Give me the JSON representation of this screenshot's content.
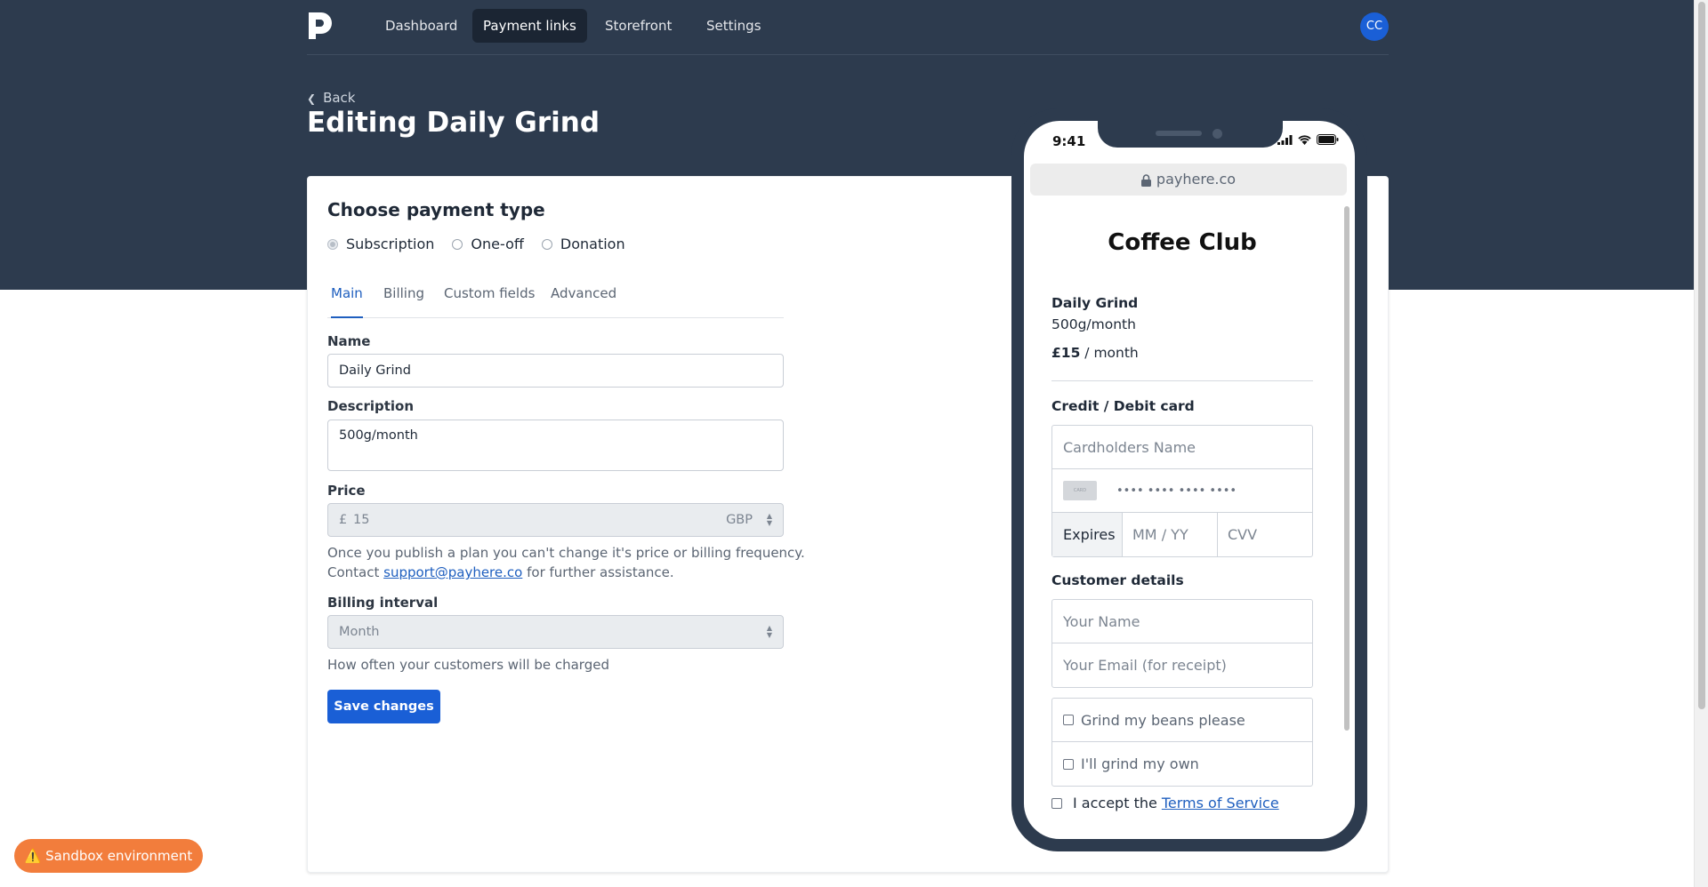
{
  "nav": {
    "items": [
      "Dashboard",
      "Payment links",
      "Storefront",
      "Settings"
    ],
    "active": "Payment links",
    "avatar": "CC"
  },
  "header": {
    "back": "Back",
    "title": "Editing Daily Grind"
  },
  "form": {
    "section_title": "Choose payment type",
    "payment_types": [
      "Subscription",
      "One-off",
      "Donation"
    ],
    "selected_type": "Subscription",
    "tabs": [
      "Main",
      "Billing",
      "Custom fields",
      "Advanced"
    ],
    "active_tab": "Main",
    "name_label": "Name",
    "name_value": "Daily Grind",
    "description_label": "Description",
    "description_value": "500g/month",
    "price_label": "Price",
    "price_currency_symbol": "£",
    "price_value": "15",
    "price_currency": "GBP",
    "price_help_1": "Once you publish a plan you can't change it's price or billing frequency.",
    "price_help_contact": "Contact",
    "support_email": "support@payhere.co",
    "price_help_2": "for further assistance.",
    "interval_label": "Billing interval",
    "interval_value": "Month",
    "interval_help": "How often your customers will be charged",
    "save_button": "Save changes"
  },
  "preview": {
    "time": "9:41",
    "url": "payhere.co",
    "store_name": "Coffee Club",
    "plan_name": "Daily Grind",
    "plan_description": "500g/month",
    "price_amount": "£15",
    "price_period": "/ month",
    "card_section": "Credit / Debit card",
    "cardholder_placeholder": "Cardholders Name",
    "card_number_placeholder": "•••• •••• •••• ••••",
    "card_icon_text": "CARD",
    "expires_label": "Expires",
    "expiry_placeholder": "MM / YY",
    "cvv_placeholder": "CVV",
    "customer_section": "Customer details",
    "name_placeholder": "Your Name",
    "email_placeholder": "Your Email (for receipt)",
    "option_1": "Grind my beans please",
    "option_2": "I'll grind my own",
    "tos_prefix": "I accept the",
    "tos_link": "Terms of Service"
  },
  "sandbox": "⚠️ Sandbox environment",
  "colors": {
    "header_bg": "#2d3b4e",
    "primary": "#1a5fd6",
    "link": "#1f5fbf",
    "sandbox": "#f27d3c"
  }
}
